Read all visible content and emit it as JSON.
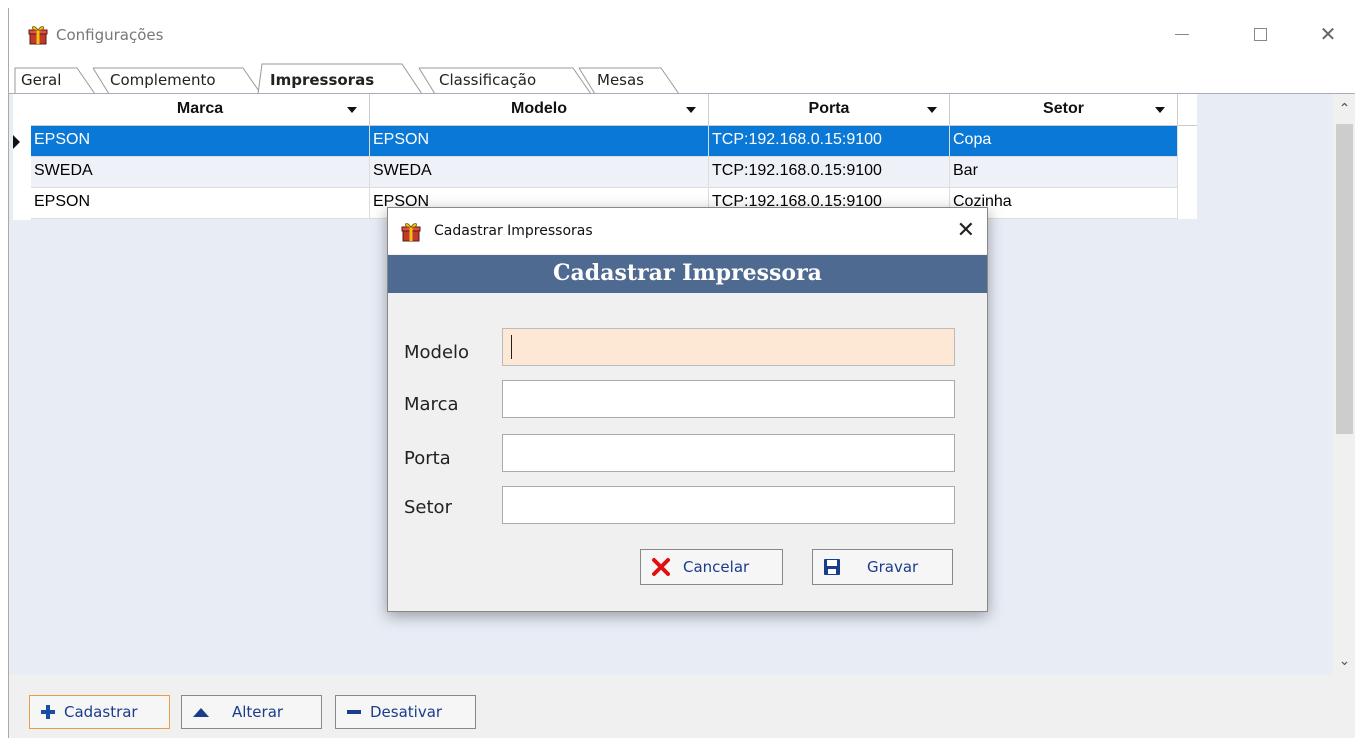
{
  "window": {
    "title": "Configurações",
    "icon": "app-gift-icon"
  },
  "tabs": [
    {
      "label": "Geral",
      "active": false
    },
    {
      "label": "Complemento",
      "active": false
    },
    {
      "label": "Impressoras",
      "active": true
    },
    {
      "label": "Classificação",
      "active": false
    },
    {
      "label": "Mesas",
      "active": false
    }
  ],
  "grid": {
    "columns": [
      "Marca",
      "Modelo",
      "Porta",
      "Setor"
    ],
    "rows": [
      [
        "EPSON",
        "EPSON",
        "TCP:192.168.0.15:9100",
        "Copa"
      ],
      [
        "SWEDA",
        "SWEDA",
        "TCP:192.168.0.15:9100",
        "Bar"
      ],
      [
        "EPSON",
        "EPSON",
        "TCP:192.168.0.15:9100",
        "Cozinha"
      ]
    ],
    "selected_row": 0
  },
  "toolbar": {
    "cadastrar": "Cadastrar",
    "alterar": "Alterar",
    "desativar": "Desativar"
  },
  "dialog": {
    "window_title": "Cadastrar Impressoras",
    "banner": "Cadastrar Impressora",
    "fields": {
      "modelo": {
        "label": "Modelo",
        "value": ""
      },
      "marca": {
        "label": "Marca",
        "value": ""
      },
      "porta": {
        "label": "Porta",
        "value": ""
      },
      "setor": {
        "label": "Setor",
        "value": ""
      }
    },
    "cancelar": "Cancelar",
    "gravar": "Gravar"
  },
  "colors": {
    "selection": "#0a78d7",
    "banner": "#4e6a90",
    "focused_input": "#fde8d6",
    "button_text": "#1a3c8c"
  }
}
